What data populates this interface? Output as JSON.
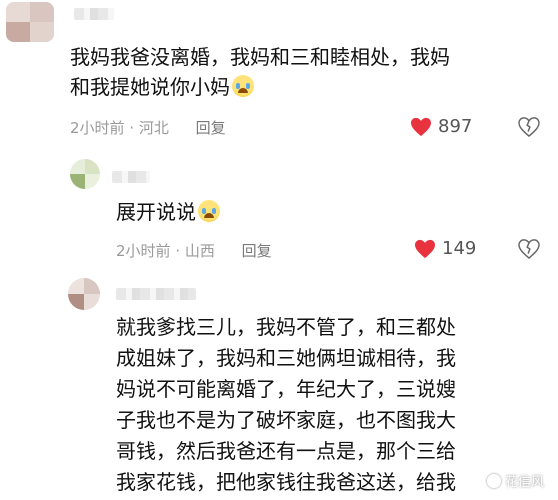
{
  "comments": [
    {
      "lines": [
        "我妈我爸没离婚，我妈和三和睦相处，我妈",
        "和我提她说你小妈"
      ],
      "emoji": "crying-laughing-emoji",
      "time": "2小时前",
      "location": "河北",
      "reply_label": "回复",
      "likes": "897"
    },
    {
      "lines": [
        "展开说说"
      ],
      "emoji": "crying-emoji",
      "time": "2小时前",
      "location": "山西",
      "reply_label": "回复",
      "likes": "149"
    },
    {
      "lines": [
        "就我爹找三儿，我妈不管了，和三都处",
        "成姐妹了，我妈和三她俩坦诚相待，我",
        "妈说不可能离婚了，年纪大了，三说嫂",
        "子我也不是为了破坏家庭，也不图我大",
        "哥钱，然后我爸还有一点是，那个三给",
        "我家花钱，把他家钱往我爸这送，给我"
      ]
    }
  ],
  "colors": {
    "like_heart": "#e8333f",
    "meta_text": "#9a9a9a"
  },
  "watermark": {
    "text": "花信风",
    "icon": "flower-icon"
  }
}
